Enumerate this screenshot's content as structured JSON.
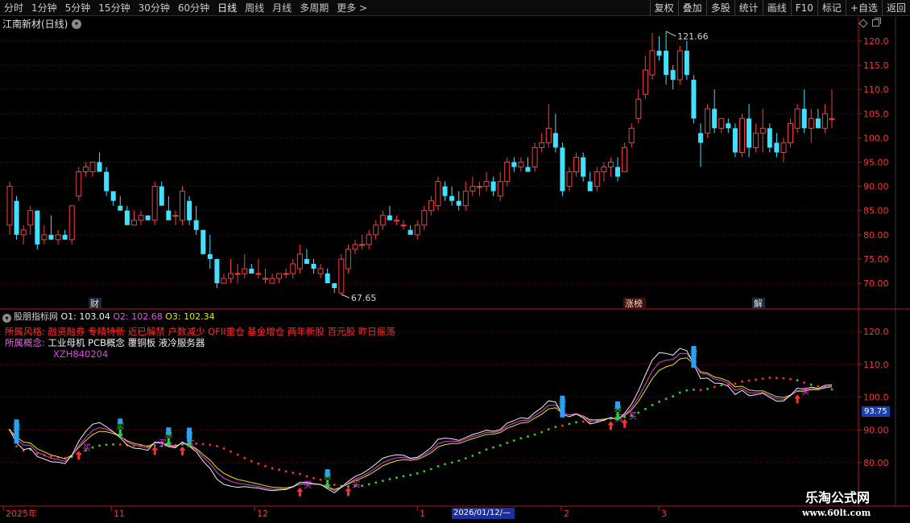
{
  "toolbar": {
    "timeframes": [
      {
        "label": "分时",
        "active": false
      },
      {
        "label": "1分钟",
        "active": false
      },
      {
        "label": "5分钟",
        "active": false
      },
      {
        "label": "15分钟",
        "active": false
      },
      {
        "label": "30分钟",
        "active": false
      },
      {
        "label": "60分钟",
        "active": false
      },
      {
        "label": "日线",
        "active": true
      },
      {
        "label": "周线",
        "active": false
      },
      {
        "label": "月线",
        "active": false
      },
      {
        "label": "多周期",
        "active": false
      },
      {
        "label": "更多 >",
        "active": false
      }
    ],
    "tools": [
      "复权",
      "叠加",
      "多股",
      "统计",
      "画线",
      "F10",
      "标记",
      "+自选",
      "返回"
    ]
  },
  "stock_title": "江南新材(日线)",
  "indicator": {
    "name": "股朋指标网",
    "o1": "O1: 103.04",
    "o2": "O2: 102.68",
    "o3": "O3: 102.34",
    "style_label": "所属风格:",
    "style_value": "融资融券 专精特新 近已解禁 户数减少 QFII重仓 基金增仓 两年新股 百元股 昨日振荡",
    "concept_label": "所属概念:",
    "concept_value": "工业母机 PCB概念 覆铜板 液冷服务器",
    "code": "XZH840204",
    "current_value": "93.75"
  },
  "watermark": {
    "line1": "乐淘公式网",
    "line2": "www.60lt.com"
  },
  "date_cursor": "2026/01/12/—",
  "colors": {
    "up": "#ff3a3a",
    "down": "#41e0ff",
    "grid": "#6e1010",
    "axis": "#b41a1a",
    "text_red": "#ff3030"
  },
  "chart_data": [
    {
      "type": "candlestick",
      "title": "江南新材(日线)",
      "ylim": [
        65,
        125
      ],
      "y_ticks": [
        "70.00",
        "75.00",
        "80.00",
        "85.00",
        "90.00",
        "95.00",
        "100.0",
        "105.0",
        "110.0",
        "115.0",
        "120.0"
      ],
      "annotations": [
        {
          "text": "121.66",
          "label": "high"
        },
        {
          "text": "67.65",
          "label": "low"
        }
      ],
      "markers": [
        "财",
        "涨榜",
        "解"
      ],
      "ohlc": [
        [
          82,
          91,
          80,
          90
        ],
        [
          87,
          88,
          79,
          80
        ],
        [
          80,
          82,
          78,
          81
        ],
        [
          82,
          86,
          80,
          85
        ],
        [
          85,
          85,
          77,
          78
        ],
        [
          79,
          82,
          78,
          80
        ],
        [
          80,
          84,
          79,
          79
        ],
        [
          79,
          81,
          78,
          80
        ],
        [
          80,
          81,
          79,
          79
        ],
        [
          79,
          86,
          78,
          86
        ],
        [
          88,
          94,
          87,
          93
        ],
        [
          93,
          95,
          92,
          94
        ],
        [
          93,
          95,
          92,
          95
        ],
        [
          95,
          97,
          94,
          93
        ],
        [
          93,
          94,
          88,
          89
        ],
        [
          89,
          89,
          86,
          87
        ],
        [
          86,
          88,
          85,
          85
        ],
        [
          85,
          86,
          82,
          82
        ],
        [
          82,
          85,
          82,
          83
        ],
        [
          83,
          85,
          82,
          84
        ],
        [
          84,
          84,
          83,
          83
        ],
        [
          83,
          91,
          82,
          90
        ],
        [
          90,
          91,
          86,
          86
        ],
        [
          85,
          88,
          83,
          83
        ],
        [
          84,
          85,
          82,
          84
        ],
        [
          83,
          90,
          82,
          89
        ],
        [
          87,
          88,
          82,
          83
        ],
        [
          83,
          86,
          80,
          81
        ],
        [
          81,
          81,
          76,
          76
        ],
        [
          76,
          80,
          73,
          75
        ],
        [
          75,
          75,
          69,
          70
        ],
        [
          70,
          72,
          70,
          71
        ],
        [
          71,
          75,
          70,
          72
        ],
        [
          72,
          74,
          70,
          72
        ],
        [
          72,
          76,
          71,
          73
        ],
        [
          73,
          74,
          72,
          72
        ],
        [
          72,
          75,
          71,
          72
        ],
        [
          71,
          73,
          70,
          71
        ],
        [
          70,
          72,
          70,
          71
        ],
        [
          71,
          72,
          70,
          72
        ],
        [
          72,
          73,
          71,
          72
        ],
        [
          72,
          75,
          71,
          74
        ],
        [
          73,
          78,
          72,
          76
        ],
        [
          75,
          77,
          74,
          74
        ],
        [
          74,
          75,
          72,
          73
        ],
        [
          72,
          74,
          71,
          73
        ],
        [
          72,
          73,
          70,
          70
        ],
        [
          70,
          70,
          68,
          69
        ],
        [
          68,
          76,
          67.65,
          75
        ],
        [
          73,
          78,
          72,
          77
        ],
        [
          77,
          79,
          76,
          78
        ],
        [
          78,
          80,
          77,
          78
        ],
        [
          78,
          81,
          77,
          80
        ],
        [
          80,
          83,
          79,
          82
        ],
        [
          82,
          85,
          81,
          84
        ],
        [
          84,
          86,
          83,
          83
        ],
        [
          83,
          84,
          82,
          83
        ],
        [
          82,
          83,
          81,
          82
        ],
        [
          81,
          82,
          80,
          80
        ],
        [
          80,
          83,
          79,
          82
        ],
        [
          82,
          86,
          81,
          85
        ],
        [
          85,
          88,
          84,
          87
        ],
        [
          86,
          92,
          85,
          91
        ],
        [
          90,
          91,
          87,
          88
        ],
        [
          88,
          90,
          86,
          87
        ],
        [
          87,
          89,
          85,
          86
        ],
        [
          86,
          91,
          85,
          89
        ],
        [
          89,
          92,
          88,
          90
        ],
        [
          90,
          91,
          88,
          90
        ],
        [
          90,
          93,
          89,
          91
        ],
        [
          91,
          92,
          88,
          89
        ],
        [
          88,
          93,
          87,
          91
        ],
        [
          91,
          96,
          90,
          95
        ],
        [
          95,
          96,
          93,
          94
        ],
        [
          94,
          96,
          93,
          95
        ],
        [
          94,
          96,
          93,
          93
        ],
        [
          94,
          99,
          93,
          98
        ],
        [
          98,
          101,
          97,
          99
        ],
        [
          99,
          107,
          98,
          102
        ],
        [
          101,
          105,
          97,
          98
        ],
        [
          98,
          99,
          88,
          89
        ],
        [
          90,
          94,
          89,
          93
        ],
        [
          93,
          97,
          92,
          96
        ],
        [
          96,
          97,
          91,
          92
        ],
        [
          91,
          93,
          89,
          89
        ],
        [
          90,
          94,
          89,
          93
        ],
        [
          93,
          95,
          91,
          94
        ],
        [
          94,
          96,
          92,
          95
        ],
        [
          94,
          96,
          91,
          92
        ],
        [
          93,
          99,
          93,
          98
        ],
        [
          99,
          103,
          98,
          102
        ],
        [
          104,
          110,
          103,
          108
        ],
        [
          109,
          117,
          108,
          114
        ],
        [
          113,
          121.66,
          112,
          118
        ],
        [
          118,
          121,
          116,
          117
        ],
        [
          118,
          122,
          111,
          113
        ],
        [
          114,
          115,
          110,
          112
        ],
        [
          112,
          119,
          111,
          118
        ],
        [
          118,
          120,
          112,
          113
        ],
        [
          112,
          113,
          103,
          104
        ],
        [
          101,
          103,
          94,
          99
        ],
        [
          101,
          107,
          100,
          106
        ],
        [
          106,
          110,
          101,
          102
        ],
        [
          102,
          103,
          101,
          104
        ],
        [
          103,
          104,
          101,
          102
        ],
        [
          102,
          103,
          96,
          97
        ],
        [
          97,
          105,
          96,
          104
        ],
        [
          104,
          107,
          96,
          98
        ],
        [
          98,
          103,
          97,
          101
        ],
        [
          101,
          106,
          97,
          102
        ],
        [
          102,
          103,
          97,
          98
        ],
        [
          99,
          101,
          96,
          97
        ],
        [
          97,
          100,
          95,
          99
        ],
        [
          99,
          104,
          98,
          103
        ],
        [
          102,
          107,
          101,
          106
        ],
        [
          106,
          110,
          101,
          102
        ],
        [
          102,
          106,
          99,
          104
        ],
        [
          104,
          106,
          102,
          102
        ],
        [
          102,
          107,
          101,
          105
        ],
        [
          104,
          110,
          102,
          104
        ]
      ]
    },
    {
      "type": "line",
      "title": "股朋指标网",
      "ylim": [
        73,
        124
      ],
      "y_ticks": [
        "80.00",
        "90.00",
        "100.0",
        "110.0",
        "120.0"
      ],
      "x_tick_labels": [
        "2025年",
        "11",
        "12",
        "1",
        "2",
        "3"
      ],
      "series": [
        {
          "name": "O1",
          "color": "#f0f0f0"
        },
        {
          "name": "O2",
          "color": "#e040e0"
        },
        {
          "name": "O3",
          "color": "#e6e600"
        }
      ],
      "buy_label": "买",
      "sell_label": "卖"
    }
  ]
}
